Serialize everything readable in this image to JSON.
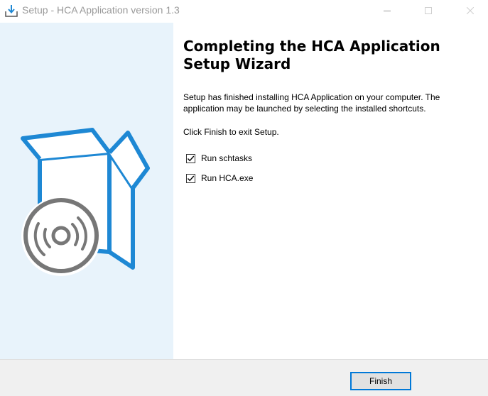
{
  "window": {
    "title": "Setup - HCA Application version 1.3",
    "icons": {
      "app": "setup-download-icon",
      "minimize": "minimize-icon",
      "maximize": "maximize-icon",
      "close": "close-icon"
    }
  },
  "sidebar": {
    "illustration": "box-with-disc-icon",
    "colors": {
      "background": "#e8f3fb",
      "box": "#1e88d4",
      "disc": "#777777"
    }
  },
  "content": {
    "heading": "Completing the HCA Application Setup Wizard",
    "body": "Setup has finished installing HCA Application on your computer. The application may be launched by selecting the installed shortcuts.",
    "exit_note": "Click Finish to exit Setup.",
    "options": [
      {
        "label": "Run schtasks",
        "checked": true
      },
      {
        "label": "Run HCA.exe",
        "checked": true
      }
    ]
  },
  "footer": {
    "finish_label": "Finish",
    "accent": "#0078d7"
  }
}
